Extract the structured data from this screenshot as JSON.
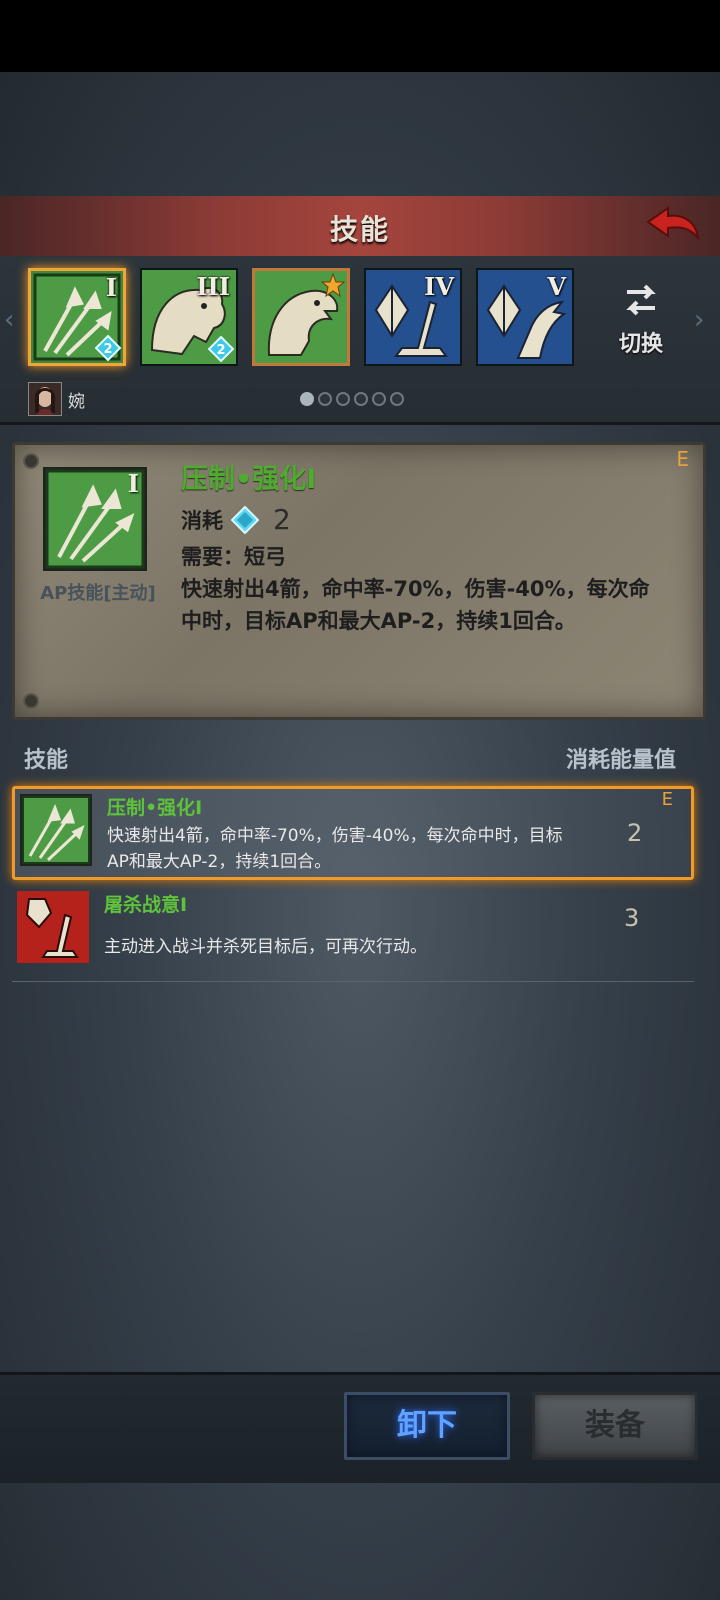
{
  "header": {
    "title": "技能"
  },
  "skill_slots": [
    {
      "numeral": "I",
      "badge": "2",
      "selected": true
    },
    {
      "numeral": "III",
      "badge": "2",
      "selected": false
    },
    {
      "numeral": "",
      "badge": "",
      "selected": false,
      "starred": true
    },
    {
      "numeral": "IV",
      "badge": "",
      "selected": false
    },
    {
      "numeral": "V",
      "badge": "",
      "selected": false
    }
  ],
  "switch_button": {
    "label": "切换"
  },
  "character": {
    "name": "婉"
  },
  "page_dots": {
    "count": 6,
    "active": 0
  },
  "detail": {
    "icon_numeral": "I",
    "ap_label": "AP技能[主动]",
    "title": "压制•强化I",
    "grade": "E",
    "cost_label": "消耗",
    "cost_value": "2",
    "requirement": "需要：短弓",
    "description": "快速射出4箭，命中率-70%，伤害-40%，每次命中时，目标AP和最大AP-2，持续1回合。"
  },
  "list": {
    "header_left": "技能",
    "header_right": "消耗能量值",
    "items": [
      {
        "title": "压制•强化I",
        "description": "快速射出4箭，命中率-70%，伤害-40%，每次命中时，目标AP和最大AP-2，持续1回合。",
        "cost": "2",
        "grade": "E"
      },
      {
        "title": "屠杀战意I",
        "description": "主动进入战斗并杀死目标后，可再次行动。",
        "cost": "3",
        "grade": ""
      }
    ]
  },
  "buttons": {
    "unequip": "卸下",
    "equip": "装备"
  },
  "colors": {
    "accent_green": "#4eab2f",
    "selected_border": "#f09a2a",
    "unequip_text": "#5fa3ff"
  }
}
